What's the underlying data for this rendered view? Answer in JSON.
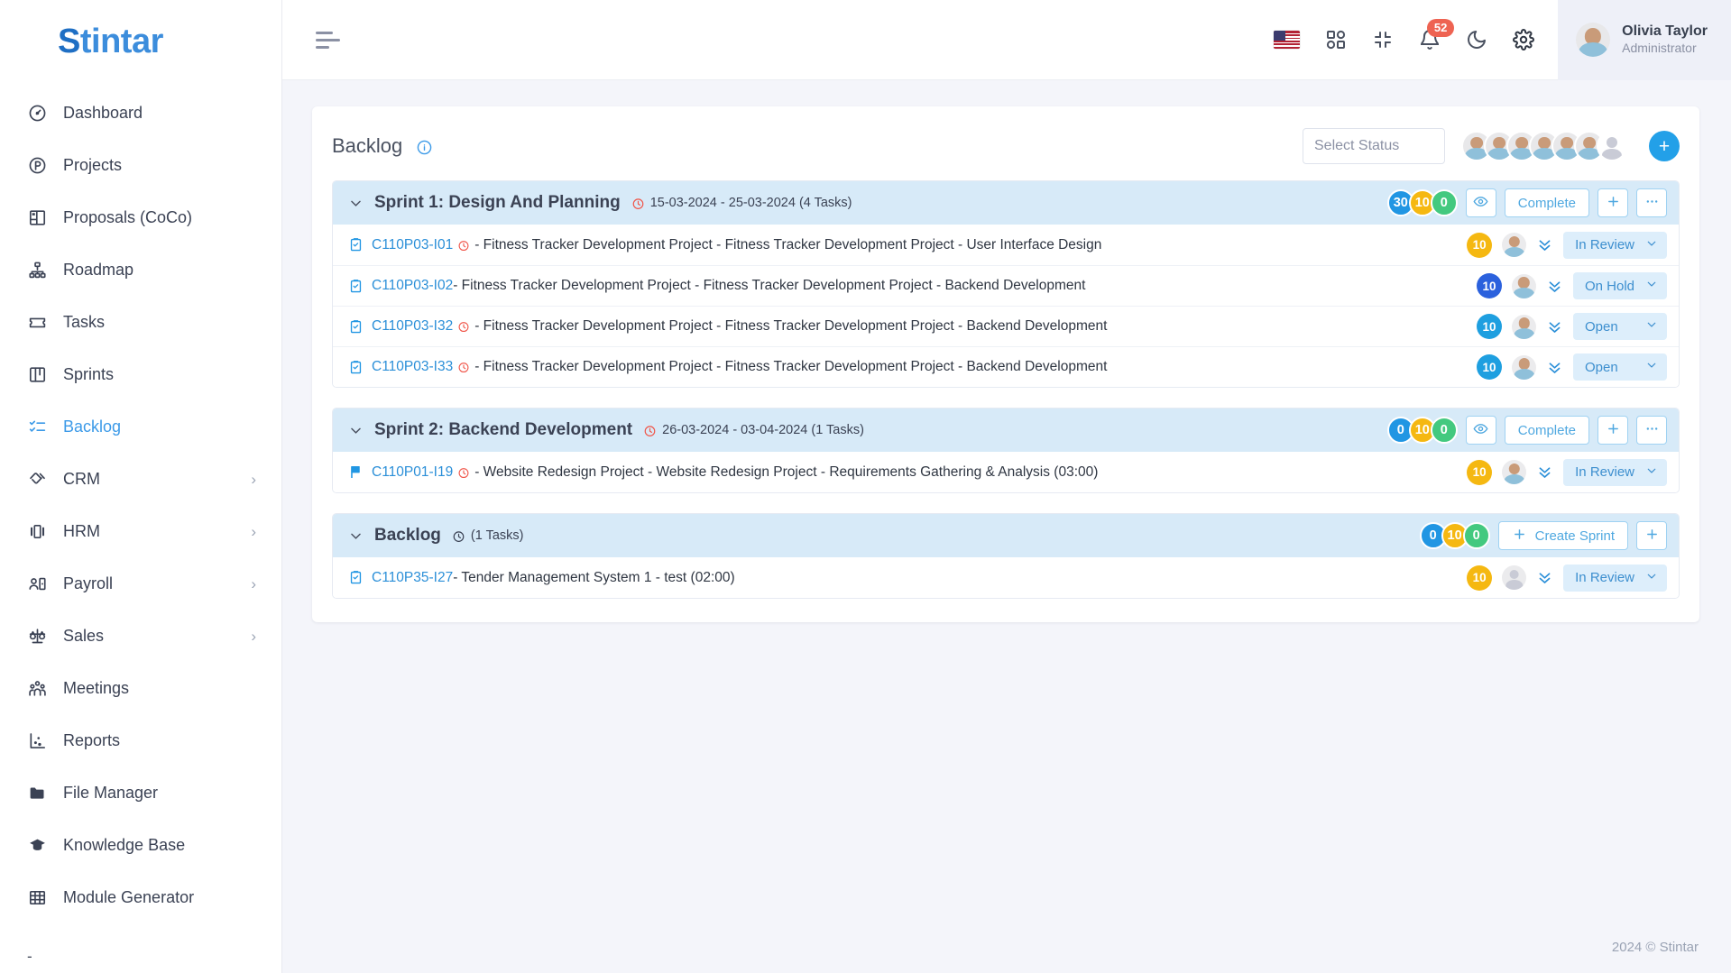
{
  "sidebar": {
    "logo": {
      "first": "S",
      "rest": "tintar"
    },
    "items": [
      {
        "label": "Dashboard",
        "icon": "gauge-icon",
        "active": false,
        "expandable": false
      },
      {
        "label": "Projects",
        "icon": "circle-p-icon",
        "active": false,
        "expandable": false
      },
      {
        "label": "Proposals (CoCo)",
        "icon": "layout-icon",
        "active": false,
        "expandable": false
      },
      {
        "label": "Roadmap",
        "icon": "sitemap-icon",
        "active": false,
        "expandable": false
      },
      {
        "label": "Tasks",
        "icon": "ticket-icon",
        "active": false,
        "expandable": false
      },
      {
        "label": "Sprints",
        "icon": "board-icon",
        "active": false,
        "expandable": false
      },
      {
        "label": "Backlog",
        "icon": "checklist-icon",
        "active": true,
        "expandable": false
      },
      {
        "label": "CRM",
        "icon": "handshake-icon",
        "active": false,
        "expandable": true
      },
      {
        "label": "HRM",
        "icon": "carousel-icon",
        "active": false,
        "expandable": true
      },
      {
        "label": "Payroll",
        "icon": "user-card-icon",
        "active": false,
        "expandable": true
      },
      {
        "label": "Sales",
        "icon": "scales-icon",
        "active": false,
        "expandable": true
      },
      {
        "label": "Meetings",
        "icon": "people-icon",
        "active": false,
        "expandable": false
      },
      {
        "label": "Reports",
        "icon": "scatter-chart-icon",
        "active": false,
        "expandable": false
      },
      {
        "label": "File Manager",
        "icon": "folder-icon",
        "active": false,
        "expandable": false
      },
      {
        "label": "Knowledge Base",
        "icon": "graduation-cap-icon",
        "active": false,
        "expandable": false
      },
      {
        "label": "Module Generator",
        "icon": "grid-table-icon",
        "active": false,
        "expandable": false
      }
    ],
    "trailing": "-"
  },
  "topbar": {
    "menu_icon": "hamburger-icon",
    "language_flag": "us-flag-icon",
    "apps_icon": "apps-grid-icon",
    "fullscreen_icon": "compress-icon",
    "notifications_icon": "bell-icon",
    "notifications_count": "52",
    "dark_mode_icon": "moon-icon",
    "settings_icon": "gear-icon",
    "user": {
      "name": "Olivia Taylor",
      "role": "Administrator"
    }
  },
  "panel": {
    "title": "Backlog",
    "info_icon": "info-circle-icon",
    "select_status_placeholder": "Select Status",
    "avatar_count": 6,
    "add_member_label": "+"
  },
  "groups": [
    {
      "name": "Sprint 1: Design And Planning",
      "clock_icon": "clock-icon",
      "clock_color": "#f0564a",
      "meta": "15-03-2024 - 25-03-2024 (4 Tasks)",
      "pills": [
        {
          "value": "30",
          "color": "blue"
        },
        {
          "value": "10",
          "color": "yellow"
        },
        {
          "value": "0",
          "color": "green"
        }
      ],
      "buttons": [
        {
          "label": "",
          "icon": "eye-icon",
          "name": "view-sprint-button"
        },
        {
          "label": "Complete",
          "icon": "",
          "name": "complete-sprint-button"
        },
        {
          "label": "",
          "icon": "plus-icon",
          "name": "add-task-button"
        },
        {
          "label": "",
          "icon": "ellipsis-icon",
          "name": "more-options-button"
        }
      ],
      "tasks": [
        {
          "icon": "clipboard-check-icon",
          "id": "C110P03-I01",
          "has_clock": true,
          "title": " - Fitness Tracker Development Project - Fitness Tracker Development Project - User Interface Design",
          "points": "10",
          "points_color": "yellow",
          "avatar": "member",
          "status": "In Review"
        },
        {
          "icon": "clipboard-check-icon",
          "id": "C110P03-I02",
          "has_clock": false,
          "title": " - Fitness Tracker Development Project - Fitness Tracker Development Project - Backend Development",
          "points": "10",
          "points_color": "darkblue",
          "avatar": "member",
          "status": "On Hold"
        },
        {
          "icon": "clipboard-check-icon",
          "id": "C110P03-I32",
          "has_clock": true,
          "title": " - Fitness Tracker Development Project - Fitness Tracker Development Project - Backend Development",
          "points": "10",
          "points_color": "blue",
          "avatar": "member",
          "status": "Open"
        },
        {
          "icon": "clipboard-check-icon",
          "id": "C110P03-I33",
          "has_clock": true,
          "title": " - Fitness Tracker Development Project - Fitness Tracker Development Project - Backend Development",
          "points": "10",
          "points_color": "blue",
          "avatar": "member",
          "status": "Open"
        }
      ]
    },
    {
      "name": "Sprint 2: Backend Development",
      "clock_icon": "clock-icon",
      "clock_color": "#f0564a",
      "meta": "26-03-2024 - 03-04-2024 (1 Tasks)",
      "pills": [
        {
          "value": "0",
          "color": "blue"
        },
        {
          "value": "10",
          "color": "yellow"
        },
        {
          "value": "0",
          "color": "green"
        }
      ],
      "buttons": [
        {
          "label": "",
          "icon": "eye-icon",
          "name": "view-sprint-button"
        },
        {
          "label": "Complete",
          "icon": "",
          "name": "complete-sprint-button"
        },
        {
          "label": "",
          "icon": "plus-icon",
          "name": "add-task-button"
        },
        {
          "label": "",
          "icon": "ellipsis-icon",
          "name": "more-options-button"
        }
      ],
      "tasks": [
        {
          "icon": "flag-icon",
          "id": "C110P01-I19",
          "has_clock": true,
          "title": " - Website Redesign Project - Website Redesign Project - Requirements Gathering & Analysis (03:00)",
          "points": "10",
          "points_color": "yellow",
          "avatar": "member",
          "status": "In Review"
        }
      ]
    },
    {
      "name": "Backlog",
      "clock_icon": "clock-icon",
      "clock_color": "#3b4254",
      "meta": "(1 Tasks)",
      "pills": [
        {
          "value": "0",
          "color": "blue"
        },
        {
          "value": "10",
          "color": "yellow"
        },
        {
          "value": "0",
          "color": "green"
        }
      ],
      "buttons": [
        {
          "label": "Create Sprint",
          "icon": "plus-icon",
          "name": "create-sprint-button"
        },
        {
          "label": "",
          "icon": "plus-icon",
          "name": "add-task-button"
        }
      ],
      "tasks": [
        {
          "icon": "clipboard-check-icon",
          "id": "C110P35-I27",
          "has_clock": false,
          "title": " - Tender Management System 1 - test (02:00)",
          "points": "10",
          "points_color": "yellow",
          "avatar": "empty",
          "status": "In Review"
        }
      ]
    }
  ],
  "footer": "2024 © Stintar"
}
